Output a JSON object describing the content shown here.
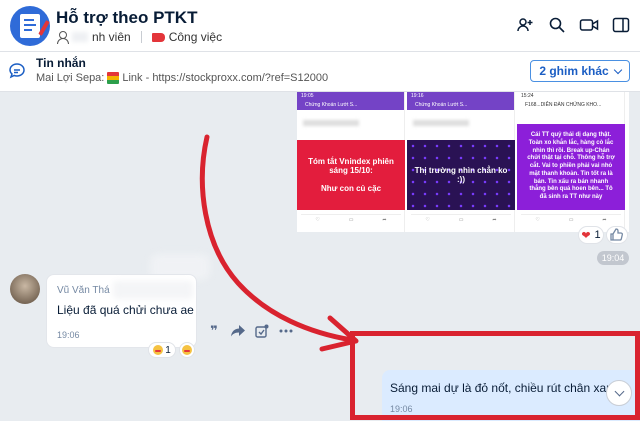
{
  "header": {
    "title": "Hỗ trợ theo PTKT",
    "members_label": "nh viên",
    "category_label": "Công việc",
    "icons": [
      "add-member-icon",
      "search-icon",
      "video-call-icon",
      "sidebar-toggle-icon"
    ]
  },
  "pinned": {
    "title": "Tin nhắn",
    "sender": "Mai Lợi Sepa:",
    "link_label": "Link - https://stockproxx.com/?ref=S12000",
    "more_button": "2 ghim khác"
  },
  "gallery": {
    "shots": [
      {
        "status": "19:05",
        "header": "Chứng Khoán Lướt S...",
        "panel": "Tóm tắt Vnindex phiên sáng 15/10:\n\nNhư con củ cặc",
        "color": "#e31d3d"
      },
      {
        "status": "19:16",
        "header": "Chứng Khoán Lướt S...",
        "panel": "Thị trường nhìn chẳn ko :))",
        "color": "#2a1254"
      },
      {
        "status": "15:24",
        "header": "F168...DIỄN ĐÀN CHỨNG KHO...",
        "panel": "Cái TT quỷ thái dị dạng thật. Toàn xo khắn lắc, hàng cò lắc nhìn thì rồi. Break up-Chán chửi thật tại chỗ. Thông hỗ trợ cắt. Vai to phiền phải vai nhỏ mặt thanh khoản. Tin tốt ra là bán. Tin xấu ra bán nhanh thẳng bên quá hoen bên... Tô đã sinh ra TT như này",
        "color": "#8c1fd9"
      }
    ],
    "reaction_count": "1",
    "time": "19:04"
  },
  "left_message": {
    "sender": "Vũ Văn Thá",
    "text": "Liệu đã quá chửi chưa ae",
    "time": "19:06",
    "reaction_count": "1"
  },
  "right_message": {
    "text": "Sáng mai dự là đỏ nốt, chiều rút chân xanh",
    "time": "19:06"
  },
  "colors": {
    "accent": "#1b5ec4",
    "annotation_red": "#d9232f",
    "outgoing_bubble": "#dbebff",
    "chat_bg": "#e8ecf0"
  }
}
